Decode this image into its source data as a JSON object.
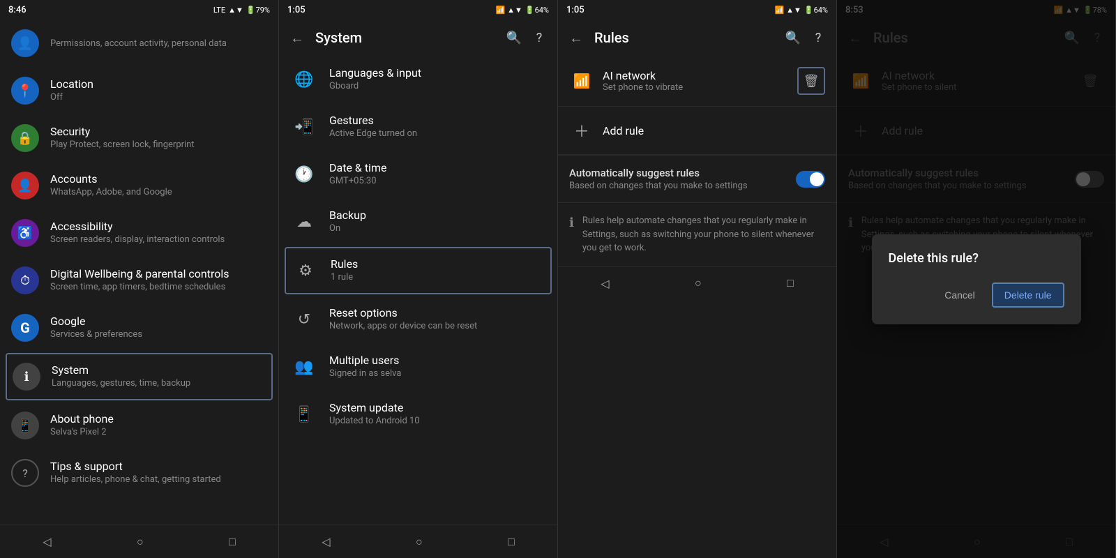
{
  "panels": {
    "panel1": {
      "statusBar": {
        "time": "8:46",
        "icons": "📶 LTE ▲▼ 🔋79%"
      },
      "settingsItems": [
        {
          "id": "google-account",
          "iconColor": "icon-blue",
          "iconSymbol": "👤",
          "title": "",
          "subtitle": "Permissions, account activity, personal data"
        },
        {
          "id": "location",
          "iconColor": "icon-blue",
          "iconSymbol": "📍",
          "title": "Location",
          "subtitle": "Off"
        },
        {
          "id": "security",
          "iconColor": "icon-green",
          "iconSymbol": "🔒",
          "title": "Security",
          "subtitle": "Play Protect, screen lock, fingerprint"
        },
        {
          "id": "accounts",
          "iconColor": "icon-red",
          "iconSymbol": "👤",
          "title": "Accounts",
          "subtitle": "WhatsApp, Adobe, and Google"
        },
        {
          "id": "accessibility",
          "iconColor": "icon-purple",
          "iconSymbol": "♿",
          "title": "Accessibility",
          "subtitle": "Screen readers, display, interaction controls"
        },
        {
          "id": "digital-wellbeing",
          "iconColor": "icon-darkblue",
          "iconSymbol": "⏱",
          "title": "Digital Wellbeing & parental controls",
          "subtitle": "Screen time, app timers, bedtime schedules"
        },
        {
          "id": "google",
          "iconColor": "icon-googleg",
          "iconSymbol": "G",
          "title": "Google",
          "subtitle": "Services & preferences"
        },
        {
          "id": "system",
          "iconColor": "icon-gray",
          "iconSymbol": "ℹ",
          "title": "System",
          "subtitle": "Languages, gestures, time, backup",
          "selected": true
        },
        {
          "id": "about-phone",
          "iconColor": "icon-gray",
          "iconSymbol": "📱",
          "title": "About phone",
          "subtitle": "Selva's Pixel 2"
        },
        {
          "id": "tips",
          "iconColor": "icon-outline",
          "iconSymbol": "?",
          "title": "Tips & support",
          "subtitle": "Help articles, phone & chat, getting started"
        }
      ],
      "navBar": {
        "back": "◁",
        "home": "○",
        "recent": "□"
      }
    },
    "panel2": {
      "statusBar": {
        "time": "1:05",
        "icons": "🕐 📶 ▲ 🔋64%"
      },
      "title": "System",
      "settingsItems": [
        {
          "id": "languages",
          "iconSymbol": "🌐",
          "title": "Languages & input",
          "subtitle": "Gboard"
        },
        {
          "id": "gestures",
          "iconSymbol": "📲",
          "title": "Gestures",
          "subtitle": "Active Edge turned on"
        },
        {
          "id": "datetime",
          "iconSymbol": "🕐",
          "title": "Date & time",
          "subtitle": "GMT+05:30"
        },
        {
          "id": "backup",
          "iconSymbol": "☁",
          "title": "Backup",
          "subtitle": "On"
        },
        {
          "id": "rules",
          "iconSymbol": "⚙",
          "title": "Rules",
          "subtitle": "1 rule",
          "selected": true
        },
        {
          "id": "reset",
          "iconSymbol": "↺",
          "title": "Reset options",
          "subtitle": "Network, apps or device can be reset"
        },
        {
          "id": "multiuser",
          "iconSymbol": "👥",
          "title": "Multiple users",
          "subtitle": "Signed in as selva"
        },
        {
          "id": "sysupdate",
          "iconSymbol": "📱",
          "title": "System update",
          "subtitle": "Updated to Android 10"
        }
      ],
      "navBar": {
        "back": "◁",
        "home": "○",
        "recent": "□"
      }
    },
    "panel3": {
      "statusBar": {
        "time": "1:05",
        "icons": "🕐 📶 ▲ 🔋64%"
      },
      "title": "Rules",
      "rule": {
        "icon": "📶",
        "title": "AI network",
        "subtitle": "Set phone to vibrate"
      },
      "addRule": "Add rule",
      "suggest": {
        "title": "Automatically suggest rules",
        "subtitle": "Based on changes that you make to settings"
      },
      "info": "Rules help automate changes that you regularly make in Settings, such as switching your phone to silent whenever you get to work.",
      "navBar": {
        "back": "◁",
        "home": "○",
        "recent": "□"
      }
    },
    "panel4": {
      "statusBar": {
        "time": "8:53",
        "icons": "🕐 📶 ▲ 🔋78%"
      },
      "title": "Rules",
      "rule": {
        "icon": "📶",
        "title": "AI network",
        "subtitle": "Set phone to silent"
      },
      "addRule": "Add rule",
      "suggest": {
        "title": "Automatically suggest rules",
        "subtitle": "Based on changes that you make to settings"
      },
      "info": "Rules help automate changes that you regularly make in Settings, such as switching your phone to silent whenever you get to work.",
      "dialog": {
        "title": "Delete this rule?",
        "cancelLabel": "Cancel",
        "deleteLabel": "Delete rule"
      },
      "navBar": {
        "back": "◁",
        "home": "○",
        "recent": "□"
      }
    }
  }
}
